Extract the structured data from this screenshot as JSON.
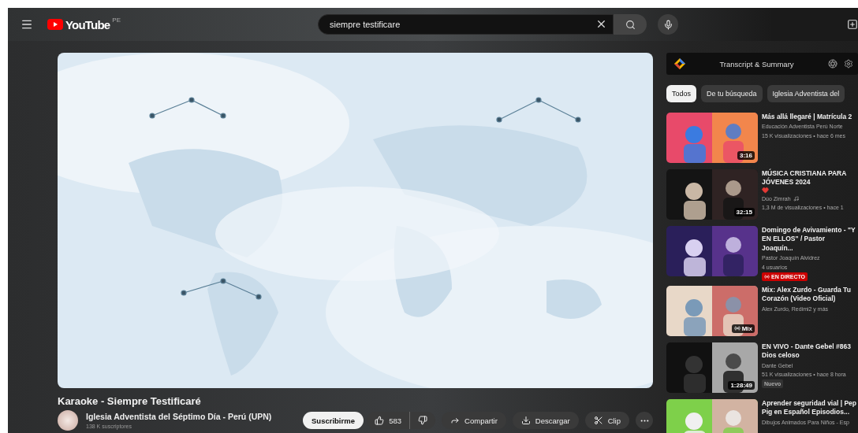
{
  "header": {
    "logo": "YouTube",
    "region": "PE",
    "search": {
      "value": "siempre testificare"
    }
  },
  "video": {
    "title": "Karaoke - Siempre Testificaré"
  },
  "channel": {
    "name": "Iglesia Adventista del Séptimo Día - Perú (UPN)",
    "subscribers": "138 K suscriptores",
    "subscribe": "Suscribirme"
  },
  "actions": [
    {
      "kind": "like",
      "text": "583"
    },
    {
      "kind": "share",
      "text": "Compartir"
    },
    {
      "kind": "download",
      "text": "Descargar"
    },
    {
      "kind": "clip",
      "text": "Clip"
    },
    {
      "kind": "more"
    }
  ],
  "extension": {
    "title": "Transcript & Summary"
  },
  "chips": [
    {
      "label": "Todos",
      "selected": true
    },
    {
      "label": "De tu búsqueda",
      "selected": false
    },
    {
      "label": "Iglesia Adventista del",
      "selected": false
    }
  ],
  "recommendations": [
    {
      "title": "Más allá llegaré | Matrícula 2",
      "heart": false,
      "channel": "Educación Adventista Perú Norte",
      "music": false,
      "meta": "15 K visualizaciones • hace 6 mes",
      "overlay": {
        "kind": "duration",
        "text": "3:16"
      }
    },
    {
      "title": "MÚSICA CRISTIANA PARA JÓVENES 2024",
      "heart": true,
      "channel": "Dúo Zimrah",
      "music": true,
      "meta": "1,3 M de visualizaciones • hace 1",
      "overlay": {
        "kind": "duration",
        "text": "32:15"
      }
    },
    {
      "title": "Domingo de Avivamiento - \"Y EN ELLOS\" / Pastor Joaquín...",
      "heart": false,
      "channel": "Pastor Joaquín Alvidrez",
      "music": false,
      "meta": "4 usuarios",
      "badge": {
        "kind": "live",
        "text": "EN DIRECTO"
      }
    },
    {
      "title": "Mix: Alex Zurdo - Guarda Tu Corazón (Video Oficial)",
      "heart": false,
      "channel": "Alex Zurdo, Redimi2 y más",
      "music": false,
      "overlay": {
        "kind": "mix",
        "text": "Mix"
      }
    },
    {
      "title": "EN VIVO - Dante Gebel #863 Dios celoso",
      "heart": false,
      "channel": "Dante Gebel",
      "music": false,
      "meta": "51 K visualizaciones • hace 8 hora",
      "badge": {
        "kind": "new",
        "text": "Nuevo"
      },
      "overlay": {
        "kind": "duration",
        "text": "1:28:49"
      }
    },
    {
      "title": "Aprender seguridad vial | Pep Pig en Español Episodios...",
      "heart": false,
      "channel": "Dibujos Animados Para Niños - Esp",
      "music": false
    }
  ]
}
